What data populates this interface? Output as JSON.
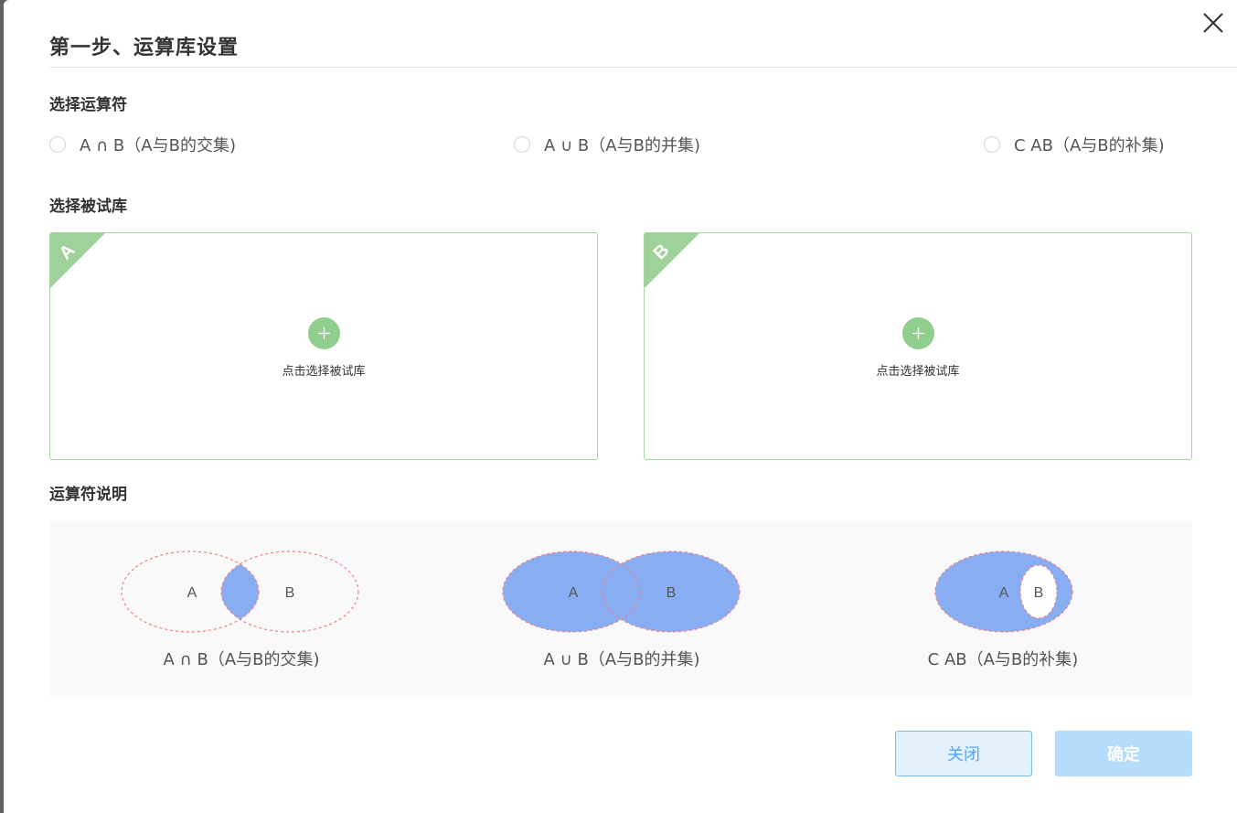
{
  "dialog": {
    "title": "第一步、运算库设置",
    "close_icon": "close-icon"
  },
  "operator_section": {
    "label": "选择运算符",
    "options": [
      {
        "text": "A ∩ B（A与B的交集)",
        "selected": false
      },
      {
        "text": "A ∪ B（A与B的并集)",
        "selected": false
      },
      {
        "text": "C AB（A与B的补集)",
        "selected": false
      }
    ]
  },
  "library_section": {
    "label": "选择被试库",
    "boxes": [
      {
        "badge": "A",
        "add_text": "点击选择被试库",
        "icon": "plus-icon"
      },
      {
        "badge": "B",
        "add_text": "点击选择被试库",
        "icon": "plus-icon"
      }
    ]
  },
  "explanation_section": {
    "label": "运算符说明",
    "diagrams": [
      {
        "set_a": "A",
        "set_b": "B",
        "caption": "A ∩ B（A与B的交集)"
      },
      {
        "set_a": "A",
        "set_b": "B",
        "caption": "A ∪ B（A与B的并集)"
      },
      {
        "set_a": "A",
        "set_b": "B",
        "caption": "C AB（A与B的补集)"
      }
    ]
  },
  "footer": {
    "close_label": "关闭",
    "ok_label": "确定"
  },
  "colors": {
    "green_accent": "#8fce8d",
    "green_border": "#a6d5a0",
    "venn_fill": "#89adf3",
    "venn_stroke": "#f08080",
    "primary_blue": "#55a6ee",
    "disabled_blue": "#b6dcfb"
  }
}
